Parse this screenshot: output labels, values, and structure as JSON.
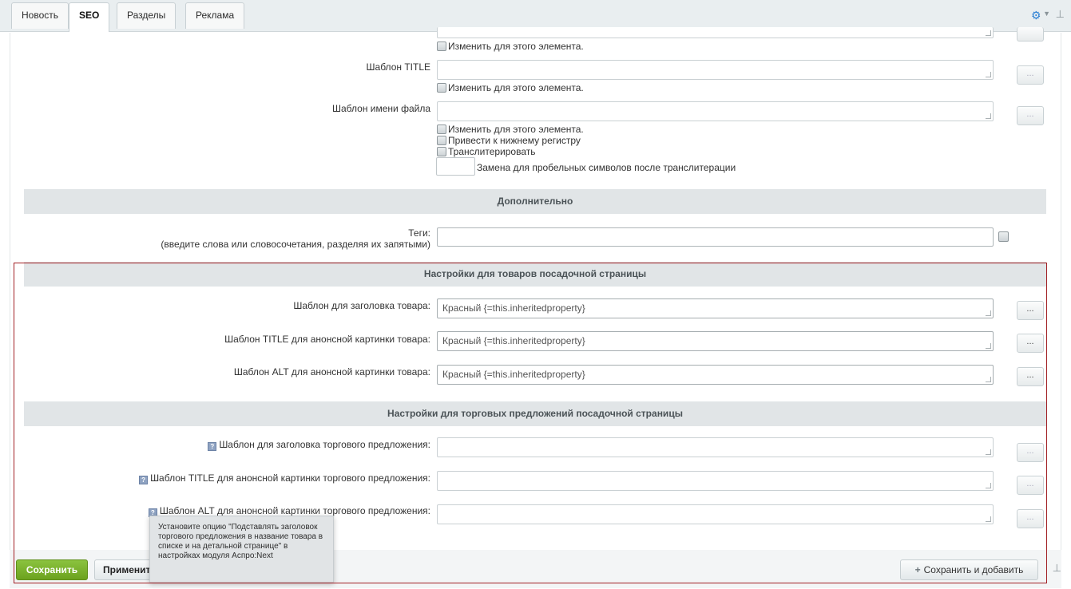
{
  "tabs": [
    {
      "label": "Новость"
    },
    {
      "label": "SEO"
    },
    {
      "label": "Разделы"
    },
    {
      "label": "Реклама"
    }
  ],
  "top_fields": {
    "change_label": "Изменить для этого элемента.",
    "title_template_label": "Шаблон TITLE",
    "filename_template_label": "Шаблон имени файла",
    "to_lowercase": "Привести к нижнему регистру",
    "transliterate": "Транслитерировать",
    "space_replacement": "Замена для пробельных символов после транслитерации",
    "dots": "..."
  },
  "additional": {
    "header": "Дополнительно",
    "tags_label": "Теги:",
    "tags_hint": "(введите слова или словосочетания, разделяя их запятыми)"
  },
  "landing_products": {
    "header": "Настройки для товаров посадочной страницы",
    "rows": [
      {
        "label": "Шаблон для заголовка товара:",
        "value": "Красный {=this.inheritedproperty}"
      },
      {
        "label": "Шаблон TITLE для анонсной картинки товара:",
        "value": "Красный {=this.inheritedproperty}"
      },
      {
        "label": "Шаблон ALT для анонсной картинки товара:",
        "value": "Красный {=this.inheritedproperty}"
      }
    ]
  },
  "landing_offers": {
    "header": "Настройки для торговых предложений посадочной страницы",
    "rows": [
      {
        "label": "Шаблон для заголовка торгового предложения:",
        "value": ""
      },
      {
        "label": "Шаблон TITLE для анонсной картинки торгового предложения:",
        "value": ""
      },
      {
        "label": "Шаблон ALT для анонсной картинки торгового предложения:",
        "value": ""
      }
    ]
  },
  "tooltip": {
    "text": "Установите опцию \"Подставлять заголовок торгового предложения в название товара в списке и на детальной странице\" в настройках модуля Аспро:Next"
  },
  "buttons": {
    "save": "Сохранить",
    "apply": "Применить",
    "save_and_add": "Сохранить и добавить"
  },
  "icons": {
    "gear": "gear-icon",
    "pin": "pin-icon",
    "hint": "question-icon",
    "plus": "plus-icon"
  },
  "colors": {
    "save_green": "#7ab52d",
    "highlight_red": "#a11f24",
    "gear_blue": "#2a7fd4"
  }
}
